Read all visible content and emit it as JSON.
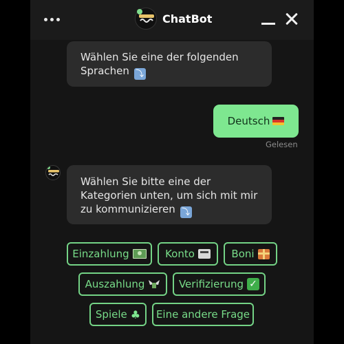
{
  "header": {
    "title": "ChatBot",
    "menu_icon": "more-dots-icon",
    "minimize_icon": "minimize-icon",
    "close_icon": "close-icon",
    "logo_icon": "chatbot-logo-icon"
  },
  "messages": {
    "bot_1": "Wählen Sie eine der folgenden Sprachen",
    "user_1": "Deutsch",
    "user_1_status": "Gelesen",
    "bot_2": "Wählen Sie bitte eine der Kategorien unten, um sich mit mir zu kommunizieren"
  },
  "quick_replies": [
    {
      "label": "Einzahlung",
      "icon": "money-icon"
    },
    {
      "label": "Konto",
      "icon": "cash-register-icon"
    },
    {
      "label": "Boni",
      "icon": "gift-icon"
    },
    {
      "label": "Auszahlung",
      "icon": "money-wings-icon"
    },
    {
      "label": "Verifizierung",
      "icon": "check-mark-icon"
    },
    {
      "label": "Spiele",
      "icon": "club-suit-icon"
    },
    {
      "label": "Eine andere Frage",
      "icon": ""
    }
  ],
  "colors": {
    "accent": "#7ee790",
    "background": "#151515",
    "bubble": "#2c2c2c",
    "header": "#1b1b1b"
  }
}
